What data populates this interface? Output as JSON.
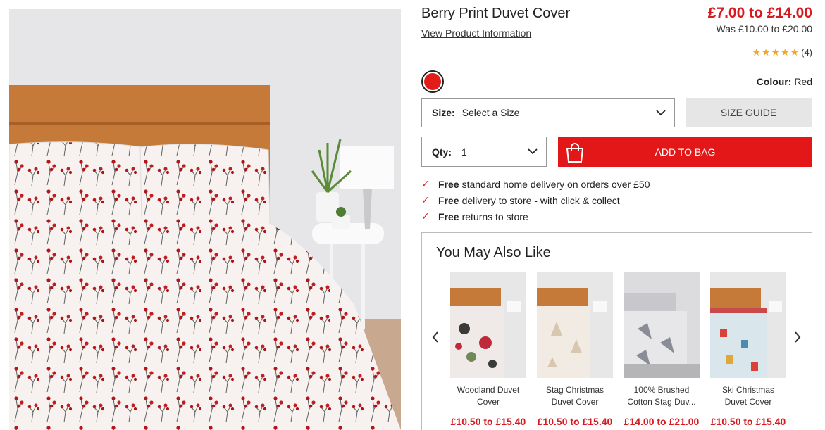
{
  "product": {
    "title": "Berry Print Duvet Cover",
    "view_info_link": "View Product Information",
    "price": "£7.00 to £14.00",
    "was_price": "Was £10.00 to £20.00",
    "rating_stars": 5,
    "review_count": "(4)",
    "colour_label": "Colour:",
    "colour_value": "Red",
    "swatch_color": "#e31b1b"
  },
  "size": {
    "label": "Size:",
    "value": "Select a Size",
    "guide_label": "SIZE GUIDE"
  },
  "qty": {
    "label": "Qty:",
    "value": "1"
  },
  "add_to_bag": "ADD TO BAG",
  "perks": [
    {
      "bold": "Free",
      "text": "standard home delivery on orders over £50"
    },
    {
      "bold": "Free",
      "text": "delivery to store - with click & collect"
    },
    {
      "bold": "Free",
      "text": "returns to store"
    }
  ],
  "recommendations": {
    "title": "You May Also Like",
    "items": [
      {
        "name": "Woodland Duvet Cover",
        "price": "£10.50 to £15.40"
      },
      {
        "name": "Stag Christmas Duvet Cover",
        "price": "£10.50 to £15.40"
      },
      {
        "name": "100% Brushed Cotton Stag Duv...",
        "price": "£14.00 to £21.00"
      },
      {
        "name": "Ski Christmas Duvet Cover",
        "price": "£10.50 to £15.40"
      }
    ]
  },
  "colors": {
    "accent": "#e31717",
    "price_red": "#d71920"
  }
}
